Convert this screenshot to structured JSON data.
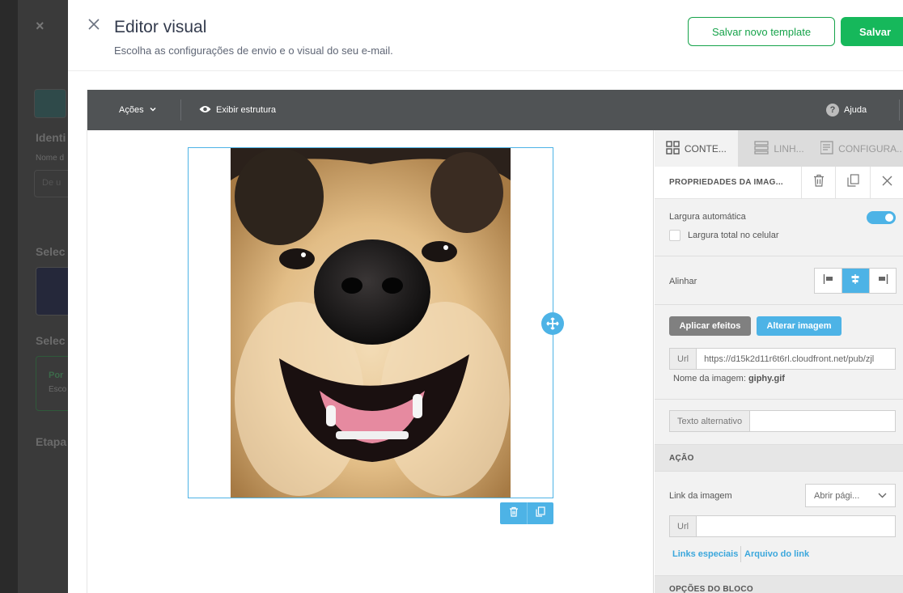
{
  "background": {
    "items": [
      "Identi",
      "Nome d",
      "De u",
      "Selec",
      "Selec",
      "Por",
      "Esco",
      "Etapa"
    ]
  },
  "modal": {
    "title": "Editor visual",
    "subtitle": "Escolha as configurações de envio e o visual do seu e-mail.",
    "btn_save_template": "Salvar novo template",
    "btn_save": "Salvar"
  },
  "toolbar": {
    "actions": "Ações",
    "show_structure": "Exibir estrutura",
    "help": "Ajuda"
  },
  "tabs": [
    {
      "label": "CONTE...",
      "icon": "grid-icon"
    },
    {
      "label": "LINH...",
      "icon": "rows-icon"
    },
    {
      "label": "CONFIGURA...",
      "icon": "settings-doc-icon"
    }
  ],
  "properties": {
    "title": "PROPRIEDADES DA IMAG...",
    "auto_width": "Largura automática",
    "full_width_mobile": "Largura total no celular",
    "align": "Alinhar",
    "apply_effects": "Aplicar efeitos",
    "change_image": "Alterar imagem",
    "url_label": "Url",
    "url_value": "https://d15k2d11r6t6rl.cloudfront.net/pub/zjl",
    "image_name_label": "Nome da imagem:",
    "image_name": "giphy.gif",
    "alt_text_label": "Texto alternativo",
    "alt_text_value": ""
  },
  "action": {
    "title": "AÇÃO",
    "image_link": "Link da imagem",
    "link_select": "Abrir pági...",
    "url_label": "Url",
    "url_value": "",
    "special_links": "Links especiais",
    "link_file": "Arquivo do link"
  },
  "block_options": {
    "title": "OPÇÕES DO BLOCO"
  },
  "colors": {
    "accent": "#4db3e6",
    "primary_green": "#16b85b",
    "toolbar_bg": "#505355"
  }
}
